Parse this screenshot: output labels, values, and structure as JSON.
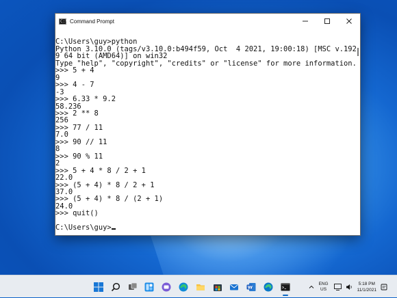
{
  "window": {
    "title": "Command Prompt",
    "icon_text": "C:\\"
  },
  "console": {
    "lines": [
      "",
      "C:\\Users\\guy>python",
      "Python 3.10.0 (tags/v3.10.0:b494f59, Oct  4 2021, 19:00:18) [MSC v.192",
      "9 64 bit (AMD64)] on win32",
      "Type \"help\", \"copyright\", \"credits\" or \"license\" for more information.",
      ">>> 5 + 4",
      "9",
      ">>> 4 - 7",
      "-3",
      ">>> 6.33 * 9.2",
      "58.236",
      ">>> 2 ** 8",
      "256",
      ">>> 77 / 11",
      "7.0",
      ">>> 90 // 11",
      "8",
      ">>> 90 % 11",
      "2",
      ">>> 5 + 4 * 8 / 2 + 1",
      "22.0",
      ">>> (5 + 4) * 8 / 2 + 1",
      "37.0",
      ">>> (5 + 4) * 8 / (2 + 1)",
      "24.0",
      ">>> quit()",
      ""
    ],
    "prompt": "C:\\Users\\guy>"
  },
  "taskbar": {
    "icons": [
      "windows-start-icon",
      "search-icon",
      "task-view-icon",
      "widgets-icon",
      "chat-icon",
      "edge-icon",
      "file-explorer-icon",
      "store-icon",
      "mail-icon",
      "word-icon",
      "edge-icon",
      "terminal-icon"
    ],
    "language_top": "ENG",
    "language_bottom": "US",
    "time": "5:18 PM",
    "date": "11/1/2021"
  },
  "colors": {
    "accent": "#0a66c2",
    "taskbar_bg": "#e8ecf1"
  }
}
